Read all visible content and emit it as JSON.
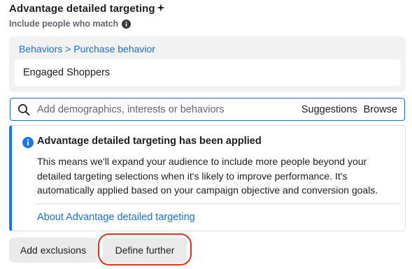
{
  "header": {
    "title": "Advantage detailed targeting",
    "sparkle_icon": "sparkle-icon",
    "subtitle": "Include people who match",
    "info_icon": "info-icon"
  },
  "targeting": {
    "breadcrumb": {
      "parent": "Behaviors",
      "separator": " > ",
      "child": "Purchase behavior"
    },
    "selected_item": "Engaged Shoppers"
  },
  "search": {
    "placeholder": "Add demographics, interests or behaviors",
    "value": "",
    "suggestions_label": "Suggestions",
    "browse_label": "Browse"
  },
  "notice": {
    "title": "Advantage detailed targeting has been applied",
    "body": "This means we'll expand your audience to include more people beyond your detailed targeting selections when it's likely to improve performance. It's automatically applied based on your campaign objective and conversion goals.",
    "link": "About Advantage detailed targeting",
    "accent_color": "#1877f2"
  },
  "actions": {
    "add_exclusions_label": "Add exclusions",
    "define_further_label": "Define further",
    "highlight_color": "#e0321f"
  }
}
